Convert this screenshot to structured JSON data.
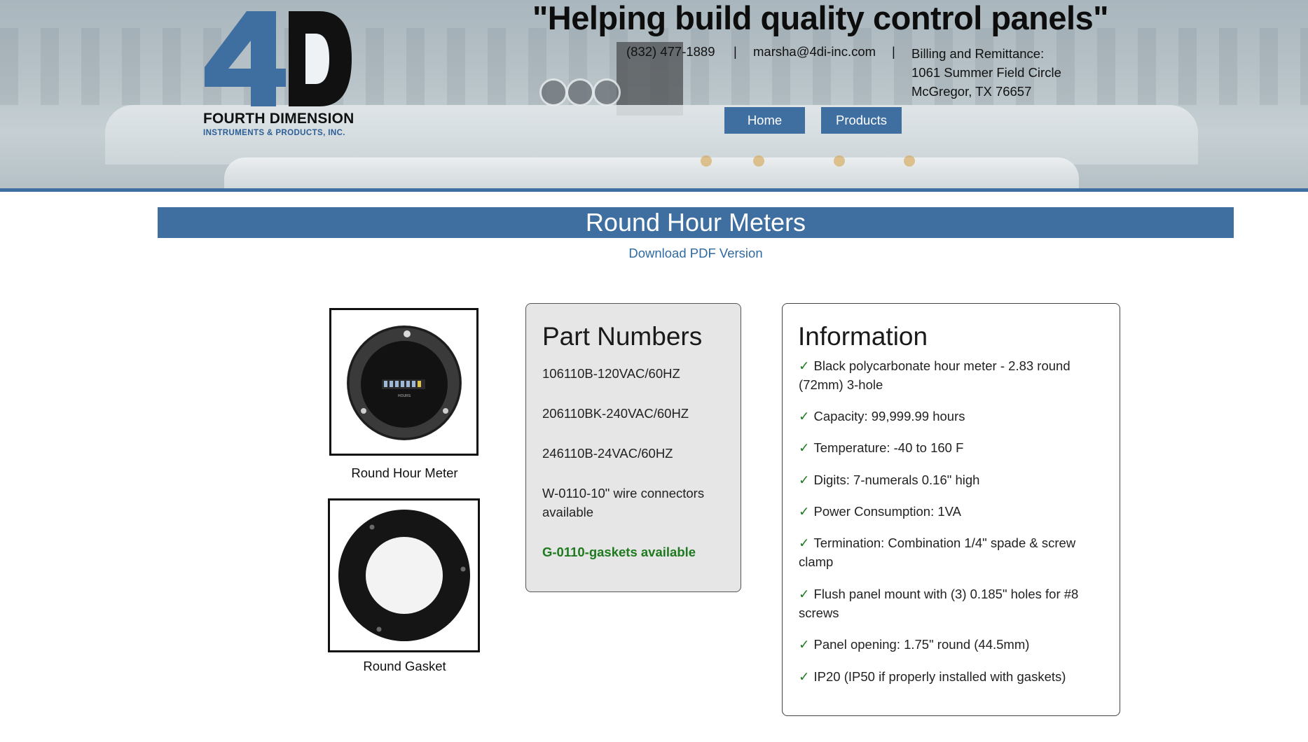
{
  "header": {
    "logo": {
      "mark": "4D",
      "name": "FOURTH DIMENSION",
      "subtitle": "INSTRUMENTS & PRODUCTS, INC."
    },
    "slogan": "\"Helping build quality control panels\"",
    "phone": "(832) 477-1889",
    "separator": "|",
    "email": "marsha@4di-inc.com",
    "billing": [
      "Billing and Remittance:",
      "1061 Summer Field Circle",
      "McGregor, TX 76657"
    ],
    "nav": [
      {
        "label": "Home"
      },
      {
        "label": "Products"
      }
    ]
  },
  "page": {
    "title": "Round Hour Meters",
    "pdf_link": "Download PDF Version"
  },
  "images": [
    {
      "caption": "Round Hour Meter",
      "meter_label": "HOURS"
    },
    {
      "caption": "Round Gasket"
    }
  ],
  "part_numbers": {
    "heading": "Part Numbers",
    "items": [
      "106110B-120VAC/60HZ",
      "206110BK-240VAC/60HZ",
      "246110B-24VAC/60HZ",
      "W-0110-10\" wire connectors available"
    ],
    "highlight": "G-0110-gaskets available"
  },
  "information": {
    "heading": "Information",
    "check_symbol": "✓",
    "items": [
      "Black polycarbonate hour meter - 2.83 round (72mm) 3-hole",
      "Capacity: 99,999.99 hours",
      "Temperature: -40 to 160 F",
      "Digits: 7-numerals 0.16\" high",
      "Power Consumption: 1VA",
      "Termination: Combination 1/4\" spade & screw clamp",
      "Flush panel mount with (3) 0.185\" holes for #8 screws",
      "Panel opening: 1.75\" round (44.5mm)",
      "IP20 (IP50 if properly installed with gaskets)"
    ]
  },
  "colors": {
    "brand_blue": "#3f6ea1",
    "link": "#2f6aa0",
    "accent_green": "#1f7a1f"
  }
}
